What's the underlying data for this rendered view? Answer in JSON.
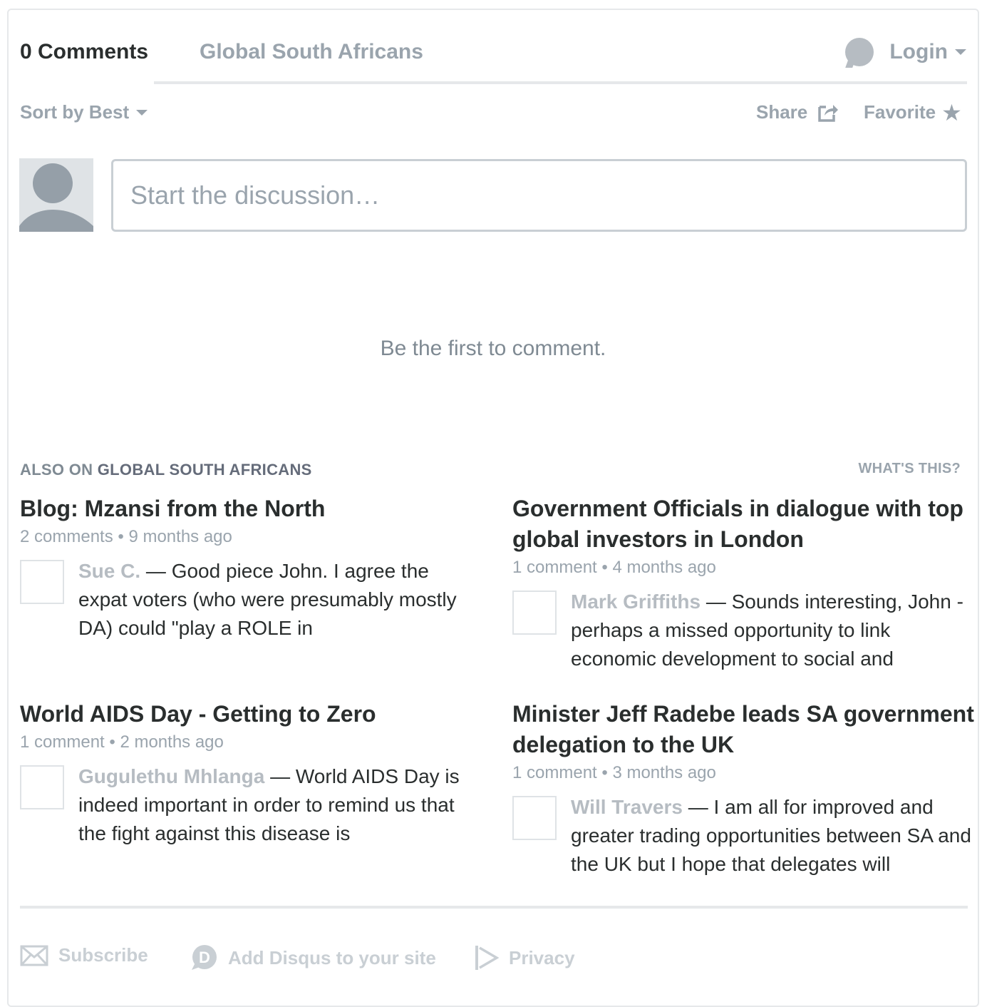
{
  "nav": {
    "comment_count": "0 Comments",
    "site_tab": "Global South Africans",
    "login_label": "Login"
  },
  "toolbar": {
    "sort_label": "Sort by Best",
    "share_label": "Share",
    "favorite_label": "Favorite"
  },
  "composer": {
    "placeholder": "Start the discussion…"
  },
  "empty_state": "Be the first to comment.",
  "also_on": {
    "prefix": "ALSO ON",
    "site": "GLOBAL SOUTH AFRICANS",
    "whats_this": "WHAT'S THIS?",
    "cards": [
      {
        "title": "Blog: Mzansi from the North",
        "meta": "2 comments • 9 months ago",
        "author": "Sue C.",
        "excerpt": "— Good piece John. I agree the expat voters (who were presumably mostly DA) could \"play a ROLE in"
      },
      {
        "title": "Government Officials in dialogue with top global investors in London",
        "meta": "1 comment • 4 months ago",
        "author": "Mark Griffiths",
        "excerpt": "— Sounds interesting, John - perhaps a missed opportunity to link economic development to social and"
      },
      {
        "title": "World AIDS Day - Getting to Zero",
        "meta": "1 comment • 2 months ago",
        "author": "Gugulethu Mhlanga",
        "excerpt": "— World AIDS Day is indeed important in order to remind us that the fight against this disease is"
      },
      {
        "title": "Minister Jeff Radebe leads SA government delegation to the UK",
        "meta": "1 comment • 3 months ago",
        "author": "Will Travers",
        "excerpt": "— I am all for improved and greater trading opportunities between SA and the UK but I hope that delegates will"
      }
    ]
  },
  "footer": {
    "subscribe": "Subscribe",
    "add_disqus": "Add Disqus to your site",
    "privacy": "Privacy"
  },
  "icons": {
    "share": "share-icon",
    "favorite": "star-icon",
    "login": "user-avatar-icon",
    "subscribe": "envelope-icon",
    "add_disqus": "disqus-icon",
    "privacy": "privacy-icon"
  }
}
